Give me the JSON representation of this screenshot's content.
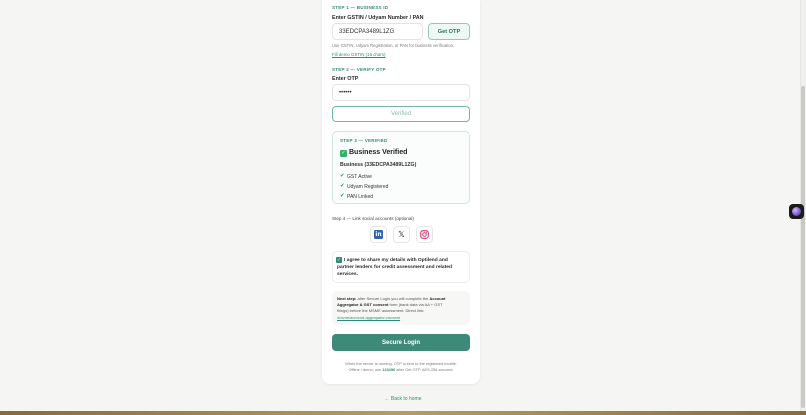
{
  "step1": {
    "label": "STEP 1 — BUSINESS ID",
    "field_label": "Enter GSTIN / Udyam Number / PAN",
    "input_value": "33EDCPA3489L1ZG",
    "otp_button": "Get OTP",
    "hint": "Use GSTIN, Udyam Registration, or PAN for business verification.",
    "demo_link": "Fill demo GSTIN (15 chars)"
  },
  "step2": {
    "label": "STEP 2 — VERIFY OTP",
    "field_label": "Enter OTP",
    "otp_value": "••••••",
    "verified_button": "Verified"
  },
  "step3": {
    "label": "STEP 3 — VERIFIED",
    "check_icon": "✓",
    "title": "Business Verified",
    "business_line": "Business (33EDCPA3489L1ZG)",
    "checks": [
      "GST Active",
      "Udyam Registered",
      "PAN Linked"
    ],
    "tick": "✔"
  },
  "step4": {
    "label": "Step 4 — Link social accounts (optional)",
    "linkedin": "in",
    "x": "𝕏",
    "instagram": "instagram-icon"
  },
  "consent": {
    "check": "✓",
    "lines": [
      "I agree to share my details with Optilend and",
      "partner lenders for credit assessment and related",
      "services."
    ]
  },
  "note": {
    "next_step": "Next step:",
    "line1_rest": " after Secure Login you will complete the ",
    "bold1": "Account",
    "bold2": "Aggregator & GST consent",
    "line2_rest": " form (bank data via AA + GST",
    "line3": "filings) before the MSME assessment. Direct link:",
    "link": "/msme/account-aggregator-consent"
  },
  "login_button": "Secure Login",
  "footer": {
    "line1": "When the server is running, OTP is sent to the registered mobile.",
    "line2_a": "Offline / demo: use ",
    "code": "123456",
    "line2_b": " after Get OTP. AES-256 secured."
  },
  "back_link": "← Back to home",
  "colors": {
    "accent": "#3d8a78",
    "link": "#2f8c74",
    "success": "#2fb36a"
  }
}
